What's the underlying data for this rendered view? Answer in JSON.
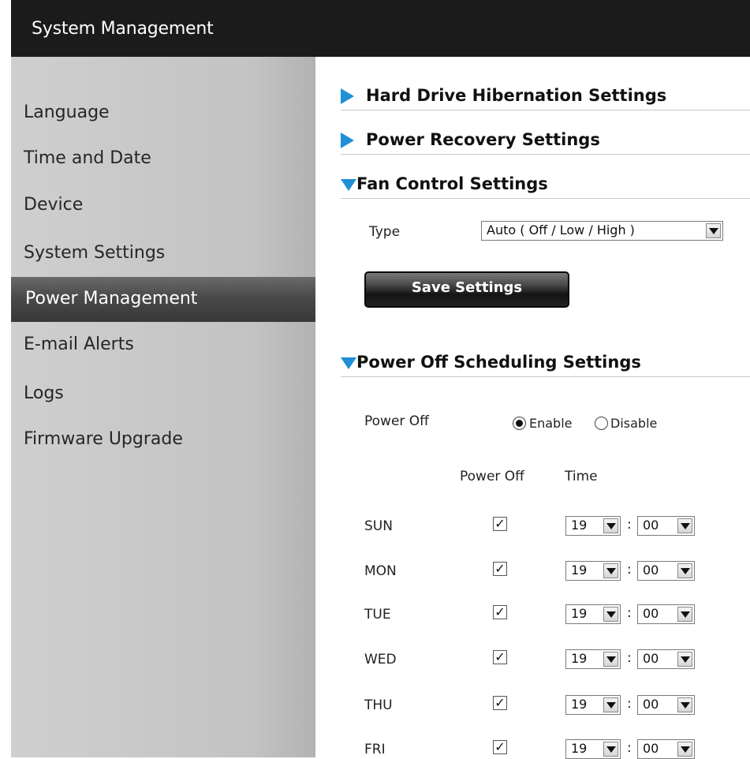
{
  "header": {
    "title": "System Management"
  },
  "sidebar": {
    "items": [
      {
        "label": "Language"
      },
      {
        "label": "Time and Date"
      },
      {
        "label": "Device"
      },
      {
        "label": "System Settings"
      },
      {
        "label": "Power Management",
        "active": true
      },
      {
        "label": "E-mail Alerts"
      },
      {
        "label": "Logs"
      },
      {
        "label": "Firmware Upgrade"
      }
    ]
  },
  "sections": {
    "hibernation": {
      "title": "Hard Drive Hibernation Settings",
      "expanded": false
    },
    "recovery": {
      "title": "Power Recovery Settings",
      "expanded": false
    },
    "fan": {
      "title": "Fan Control Settings",
      "expanded": true,
      "type_label": "Type",
      "type_value": "Auto ( Off / Low / High )",
      "save_label": "Save Settings"
    },
    "schedule": {
      "title": "Power Off Scheduling Settings",
      "expanded": true,
      "power_off_label": "Power Off",
      "enable_label": "Enable",
      "disable_label": "Disable",
      "selected": "Enable",
      "col_power_off": "Power Off",
      "col_time": "Time",
      "days": [
        {
          "day": "SUN",
          "checked": true,
          "hour": "19",
          "minute": "00"
        },
        {
          "day": "MON",
          "checked": true,
          "hour": "19",
          "minute": "00"
        },
        {
          "day": "TUE",
          "checked": true,
          "hour": "19",
          "minute": "00"
        },
        {
          "day": "WED",
          "checked": true,
          "hour": "19",
          "minute": "00"
        },
        {
          "day": "THU",
          "checked": true,
          "hour": "19",
          "minute": "00"
        },
        {
          "day": "FRI",
          "checked": true,
          "hour": "19",
          "minute": "00"
        }
      ]
    }
  },
  "colors": {
    "accent": "#1f8fd6",
    "header_bg": "#1b1b1b",
    "sidebar_bg": "#c3c3c3",
    "active_bg": "#4a4a4a"
  }
}
